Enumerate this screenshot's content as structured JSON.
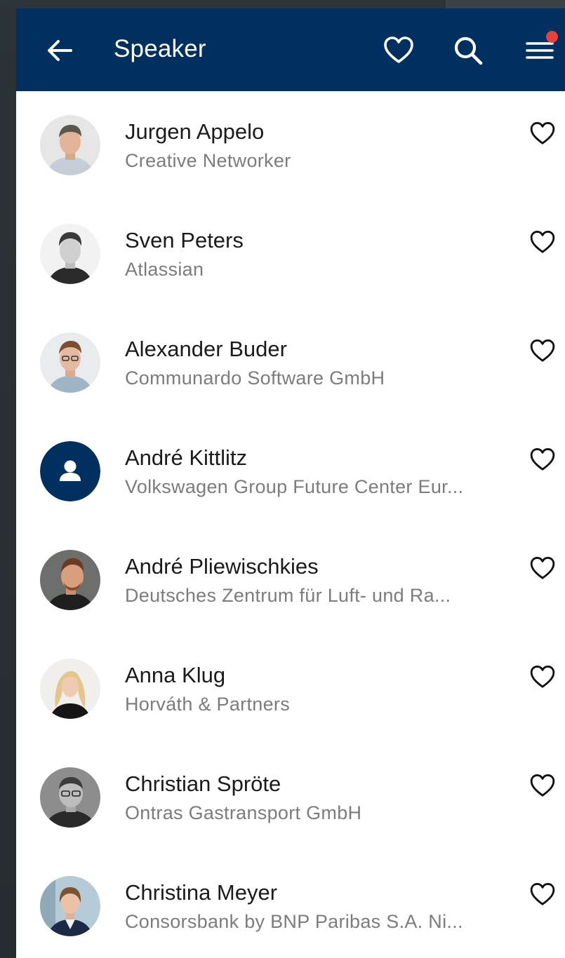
{
  "colors": {
    "appbar": "#00305f",
    "notification_dot": "#e8403c",
    "name_text": "#1b1b1b",
    "org_text": "#7c7c7c"
  },
  "header": {
    "title": "Speaker",
    "back_icon": "arrow-left-icon",
    "favorites_icon": "heart-outline-icon",
    "search_icon": "search-icon",
    "menu_icon": "menu-icon",
    "menu_has_notification": true
  },
  "speakers": [
    {
      "name": "Jurgen Appelo",
      "org": "Creative Networker",
      "favorite": false,
      "avatar": "photo"
    },
    {
      "name": "Sven Peters",
      "org": "Atlassian",
      "favorite": false,
      "avatar": "photo"
    },
    {
      "name": "Alexander Buder",
      "org": "Communardo Software GmbH",
      "favorite": false,
      "avatar": "photo"
    },
    {
      "name": "André Kittlitz",
      "org": "Volkswagen Group Future Center Eur...",
      "favorite": false,
      "avatar": "placeholder"
    },
    {
      "name": "André Pliewischkies",
      "org": "Deutsches Zentrum für Luft- und Ra...",
      "favorite": false,
      "avatar": "photo"
    },
    {
      "name": "Anna Klug",
      "org": "Horváth & Partners",
      "favorite": false,
      "avatar": "photo"
    },
    {
      "name": "Christian Spröte",
      "org": "Ontras Gastransport GmbH",
      "favorite": false,
      "avatar": "photo"
    },
    {
      "name": "Christina Meyer",
      "org": "Consorsbank by BNP Paribas S.A. Ni...",
      "favorite": false,
      "avatar": "photo"
    }
  ]
}
